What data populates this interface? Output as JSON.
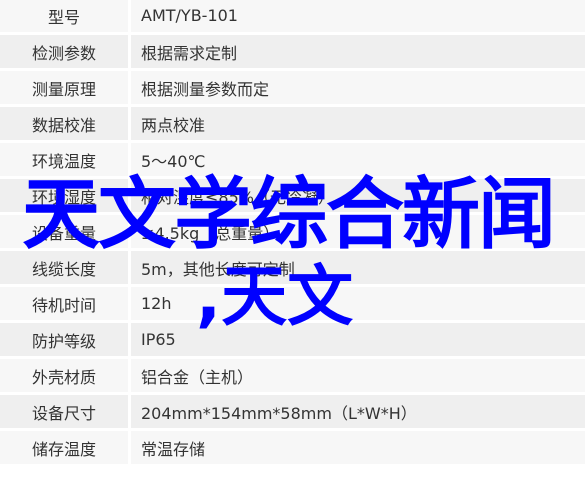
{
  "rows": [
    {
      "k": "型号",
      "v": "AMT/YB-101"
    },
    {
      "k": "检测参数",
      "v": "根据需求定制"
    },
    {
      "k": "测量原理",
      "v": "根据测量参数而定"
    },
    {
      "k": "数据校准",
      "v": "两点校准"
    },
    {
      "k": "环境温度",
      "v": "5～40℃"
    },
    {
      "k": "环境湿度",
      "v": "相对湿度≤85%（无冷凝）"
    },
    {
      "k": "设备重量",
      "v": "≤4.5kg（总重量）"
    },
    {
      "k": "线缆长度",
      "v": "5m，其他长度可定制"
    },
    {
      "k": "待机时间",
      "v": "12h"
    },
    {
      "k": "防护等级",
      "v": "IP65"
    },
    {
      "k": "外壳材质",
      "v": "铝合金（主机）"
    },
    {
      "k": "设备尺寸",
      "v": "204mm*154mm*58mm（L*W*H）"
    },
    {
      "k": "储存温度",
      "v": "常温存储"
    }
  ],
  "overlay": {
    "line1": "天文学综合新闻",
    "line2": ",天文",
    "color": "#0000ff"
  }
}
